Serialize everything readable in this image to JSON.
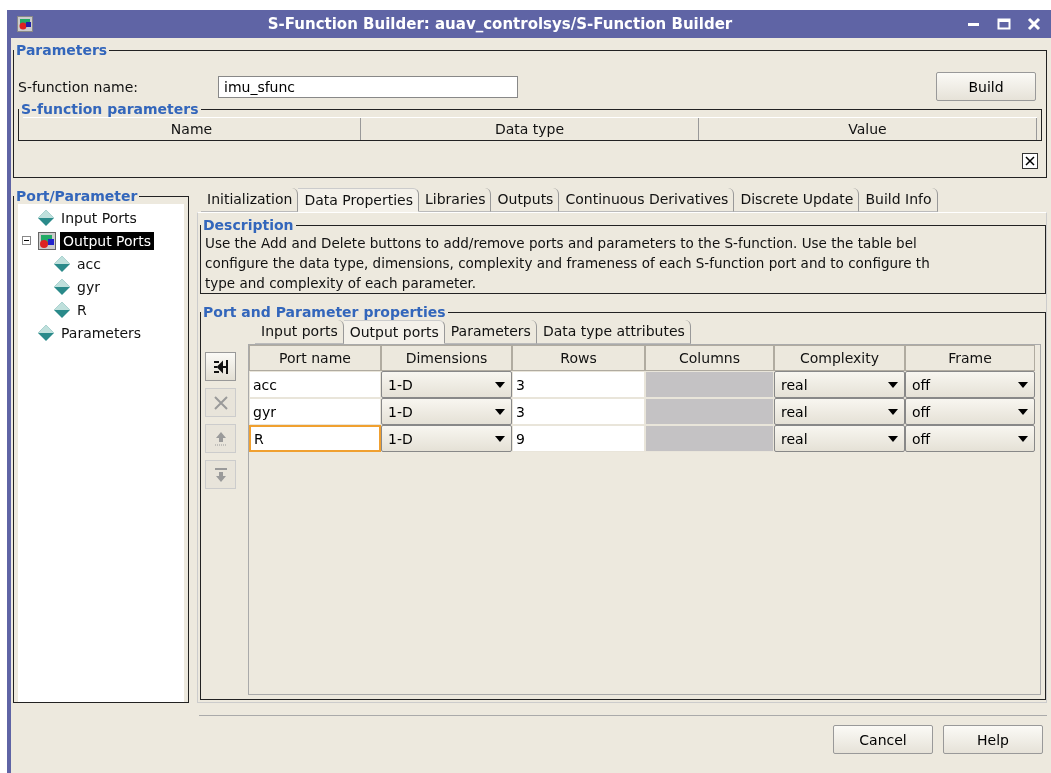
{
  "window": {
    "title": "S-Function Builder: auav_controlsys/S-Function Builder"
  },
  "parameters": {
    "title": "Parameters",
    "name_label": "S-function name:",
    "name_value": "imu_sfunc",
    "build_button": "Build",
    "sfunc_params": {
      "title": "S-function parameters",
      "columns": [
        "Name",
        "Data type",
        "Value"
      ]
    }
  },
  "tree": {
    "title": "Port/Parameter",
    "items": [
      {
        "label": "Input Ports",
        "kind": "port",
        "selected": false
      },
      {
        "label": "Output Ports",
        "kind": "block",
        "selected": true,
        "expanded": true,
        "children": [
          {
            "label": "acc",
            "kind": "port",
            "selected": false
          },
          {
            "label": "gyr",
            "kind": "port",
            "selected": false
          },
          {
            "label": "R",
            "kind": "port",
            "selected": false
          }
        ]
      },
      {
        "label": "Parameters",
        "kind": "port",
        "selected": false
      }
    ]
  },
  "tabs": [
    {
      "label": "Initialization",
      "selected": false
    },
    {
      "label": "Data Properties",
      "selected": true
    },
    {
      "label": "Libraries",
      "selected": false
    },
    {
      "label": "Outputs",
      "selected": false
    },
    {
      "label": "Continuous Derivatives",
      "selected": false
    },
    {
      "label": "Discrete Update",
      "selected": false
    },
    {
      "label": "Build Info",
      "selected": false
    }
  ],
  "description": {
    "title": "Description",
    "lines": [
      "Use the Add and Delete buttons to add/remove ports and parameters to the S-function. Use the table bel",
      "configure the data type, dimensions, complexity and frameness of each S-function port and to configure th",
      "type and complexity of each parameter."
    ]
  },
  "properties": {
    "title": "Port and Parameter properties",
    "tabs": [
      {
        "label": "Input ports",
        "selected": false
      },
      {
        "label": "Output ports",
        "selected": true
      },
      {
        "label": "Parameters",
        "selected": false
      },
      {
        "label": "Data type attributes",
        "selected": false
      }
    ],
    "side_buttons": [
      {
        "kind": "add",
        "disabled": false
      },
      {
        "kind": "delete",
        "disabled": true
      },
      {
        "kind": "up",
        "disabled": true
      },
      {
        "kind": "down",
        "disabled": true
      }
    ],
    "table": {
      "columns": [
        "Port name",
        "Dimensions",
        "Rows",
        "Columns",
        "Complexity",
        "Frame"
      ],
      "rows": [
        {
          "port_name": "acc",
          "dimensions": "1-D",
          "rows": "3",
          "complexity": "real",
          "frame": "off",
          "focused": false
        },
        {
          "port_name": "gyr",
          "dimensions": "1-D",
          "rows": "3",
          "complexity": "real",
          "frame": "off",
          "focused": false
        },
        {
          "port_name": "R",
          "dimensions": "1-D",
          "rows": "9",
          "complexity": "real",
          "frame": "off",
          "focused": true
        }
      ]
    }
  },
  "buttons": [
    "Cancel",
    "Help"
  ]
}
